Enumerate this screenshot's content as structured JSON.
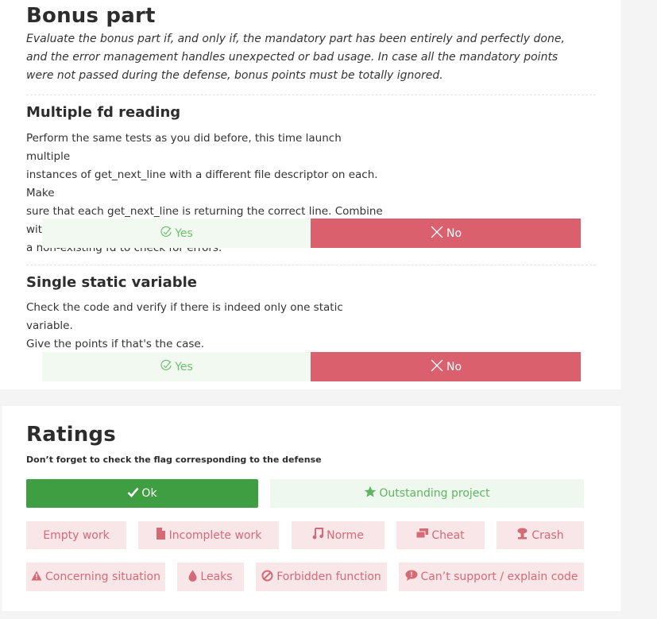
{
  "bonus": {
    "title": "Bonus part",
    "intro": "Evaluate the bonus part if, and only if, the mandatory part has been entirely and perfectly done, and the error management handles unexpected or bad usage. In case all the mandatory points were not passed during the defense, bonus points must be totally ignored.",
    "sections": [
      {
        "title": "Multiple fd reading",
        "lines": [
          "Perform the same tests as you did before, this time launch multiple",
          "instances of get_next_line with a different file descriptor on each. Make",
          "sure that each get_next_line is returning the correct line. Combine with",
          "a non-existing fd to check for errors."
        ],
        "yes_label": "Yes",
        "no_label": "No"
      },
      {
        "title": "Single static variable",
        "lines": [
          "Check the code and verify if there is indeed only one static variable.",
          "Give the points if that's the case."
        ],
        "yes_label": "Yes",
        "no_label": "No"
      }
    ]
  },
  "ratings": {
    "title": "Ratings",
    "subtitle": "Don’t forget to check the flag corresponding to the defense",
    "ok_label": "Ok",
    "outstanding_label": "Outstanding project",
    "flags_row1": [
      "Empty work",
      "Incomplete work",
      "Norme",
      "Cheat",
      "Crash"
    ],
    "flags_row2": [
      "Concerning situation",
      "Leaks",
      "Forbidden function",
      "Can’t support / explain code"
    ]
  },
  "colors": {
    "yes_bg": "#f1f9f1",
    "no_bg": "#d9606c",
    "ok_bg": "#3e9e41",
    "flag_bg": "#f9e6e8",
    "flag_text": "#d46a76"
  }
}
